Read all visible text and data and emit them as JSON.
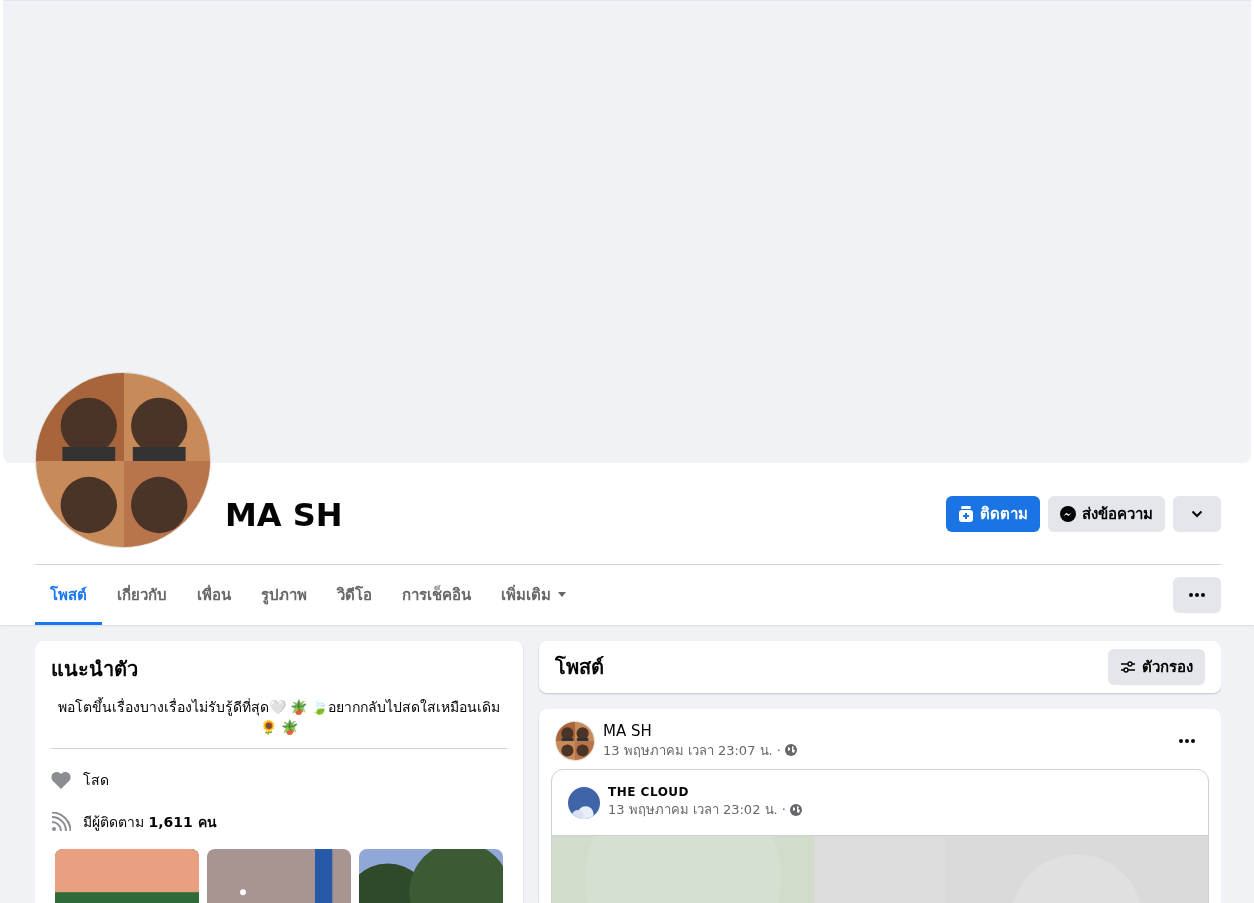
{
  "profile": {
    "name": "MA SH"
  },
  "actions": [
    {
      "kind": "primary",
      "label": "ติดตาม"
    },
    {
      "kind": "secondary",
      "label": "ส่งข้อความ"
    },
    {
      "kind": "dropdown"
    }
  ],
  "tabs": [
    {
      "label": "โพสต์",
      "selected": true
    },
    {
      "label": "เกี่ยวกับ",
      "selected": false
    },
    {
      "label": "เพื่อน",
      "selected": false
    },
    {
      "label": "รูปภาพ",
      "selected": false
    },
    {
      "label": "วิดีโอ",
      "selected": false
    },
    {
      "label": "การเช็คอิน",
      "selected": false
    },
    {
      "label": "เพิ่มเติม",
      "selected": false,
      "has_menu": true
    }
  ],
  "intro": {
    "title": "แนะนำตัว",
    "bio": "พอโตขึ้นเรื่องบางเรื่องไม่รับรู้ดีที่สุด🤍 🪴 🍃อยากกลับไปสดใสเหมือนเดิม 🌻 🪴",
    "details": [
      {
        "kind": "relationship",
        "text": "โสด"
      },
      {
        "kind": "followers",
        "text": "มีผู้ติดตาม **1,611 คน**"
      }
    ]
  },
  "posts_header": {
    "title": "โพสต์",
    "filter_button": "ตัวกรอง"
  },
  "post": {
    "author": "MA SH",
    "time": "13 พฤษภาคม เวลา 23:07 น. ·",
    "shared": {
      "author": "THE CLOUD",
      "time": "13 พฤษภาคม เวลา 23:02 น. ·"
    }
  }
}
